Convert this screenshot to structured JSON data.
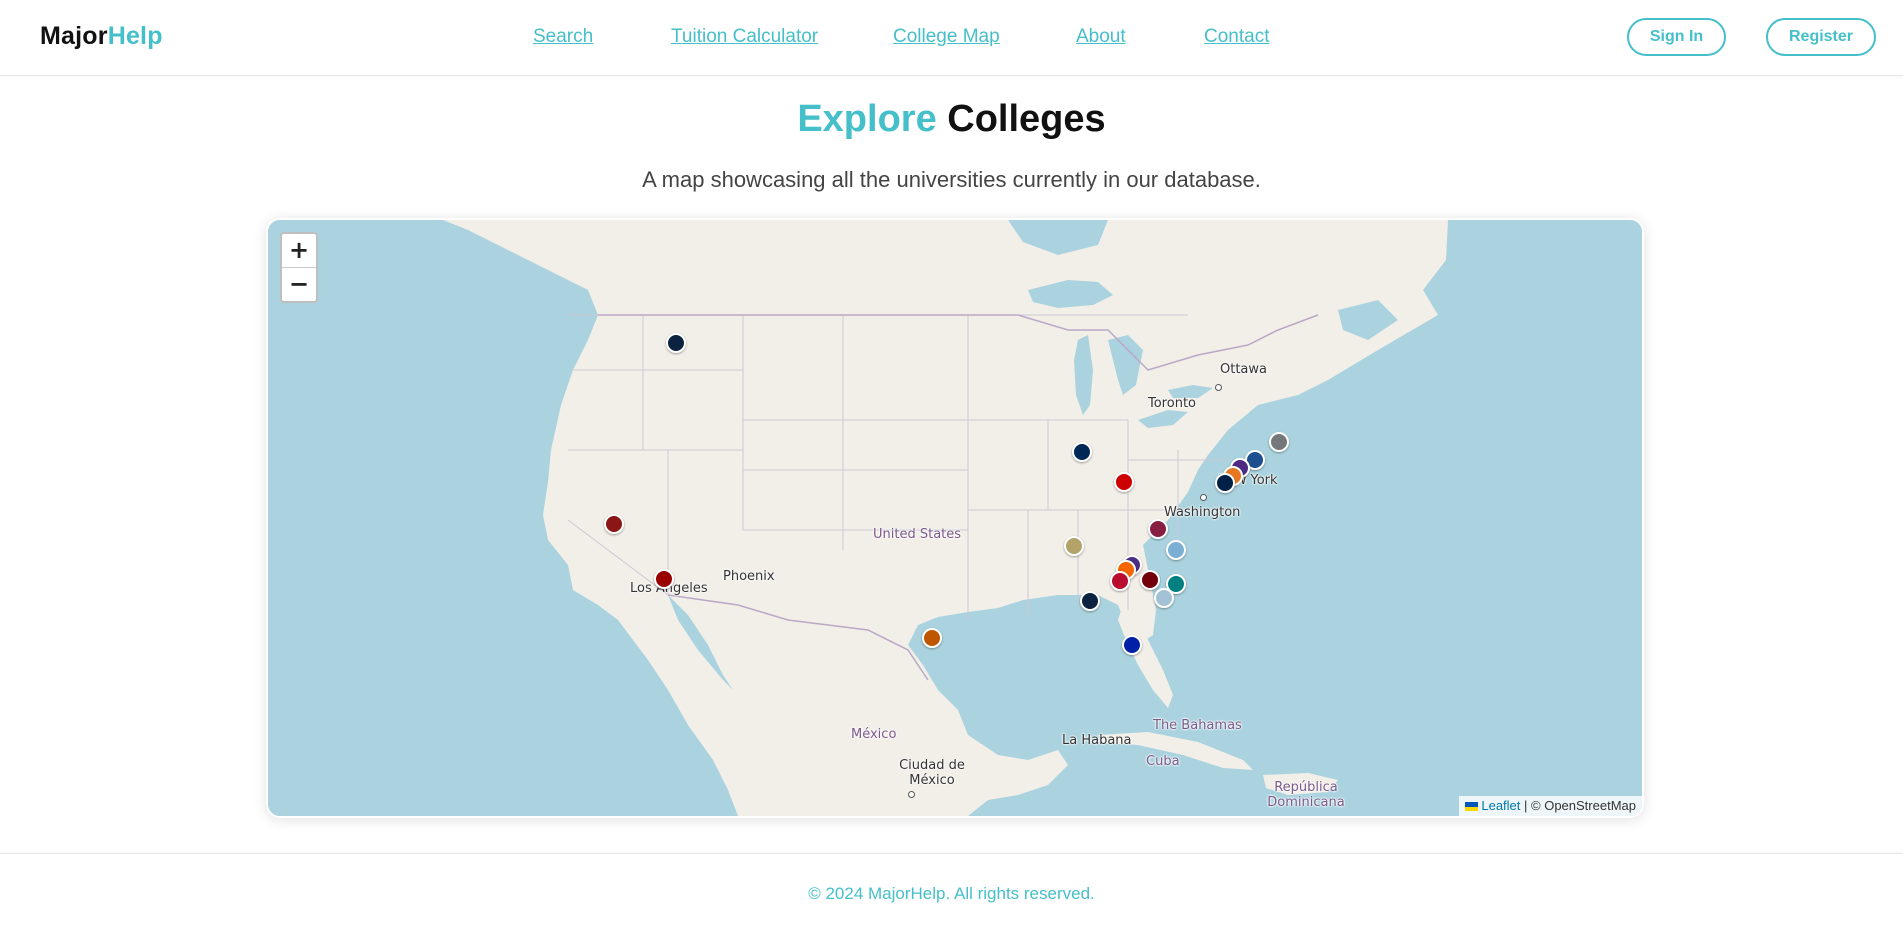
{
  "header": {
    "logo_part1": "Major",
    "logo_part2": "Help",
    "nav": [
      {
        "label": "Search"
      },
      {
        "label": "Tuition Calculator"
      },
      {
        "label": "College Map"
      },
      {
        "label": "About"
      },
      {
        "label": "Contact"
      }
    ],
    "sign_in": "Sign In",
    "register": "Register"
  },
  "hero": {
    "title_part1": "Explore",
    "title_part2": "Colleges",
    "subtitle": "A map showcasing all the universities currently in our database."
  },
  "map": {
    "zoom_in": "+",
    "zoom_out": "−",
    "attribution_link": "Leaflet",
    "attribution_rest": "| © OpenStreetMap",
    "labels": {
      "ottawa": "Ottawa",
      "toronto": "Toronto",
      "new_york": "New York",
      "washington": "Washington",
      "united_states": "United States",
      "phoenix": "Phoenix",
      "los_angeles": "Los Angeles",
      "mexico": "México",
      "ciudad_de_mexico": "Ciudad de México",
      "la_habana": "La Habana",
      "bahamas": "The Bahamas",
      "cuba": "Cuba",
      "republica_dominicana": "República Dominicana"
    },
    "marker_colors": [
      "#0c2340",
      "#8c1515",
      "#990000",
      "#bf5700",
      "#002855",
      "#cc0000",
      "#75787b",
      "#1d4f91",
      "#4e2a84",
      "#e87722",
      "#002147",
      "#861f41",
      "#b3a369",
      "#4b2e83",
      "#7bafd4",
      "#f56600",
      "#73000a",
      "#ba0c2f",
      "#008080",
      "#0b2341",
      "#a4c2d5",
      "#0021a5"
    ]
  },
  "footer": {
    "copyright": "© 2024 MajorHelp. All rights reserved."
  }
}
